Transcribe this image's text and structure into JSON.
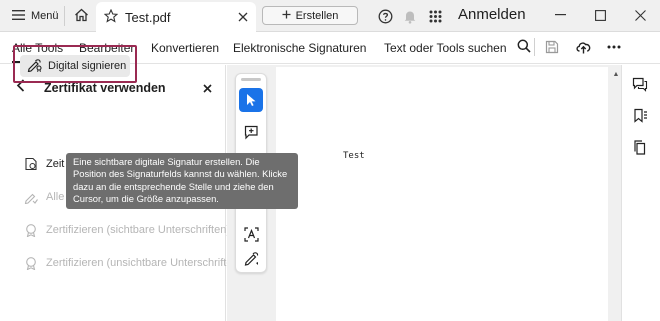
{
  "titlebar": {
    "menu_label": "Menü",
    "tab_title": "Test.pdf",
    "new_label": "Erstellen",
    "signin_label": "Anmelden",
    "icons": [
      "hamburger-menu-icon",
      "home-icon",
      "star-icon",
      "close-icon",
      "plus-icon",
      "help-icon",
      "bell-icon",
      "apps-grid-icon",
      "minimize-icon",
      "maximize-icon",
      "window-close-icon"
    ]
  },
  "toolbar": {
    "tabs": [
      {
        "label": "Alle Tools",
        "active": true
      },
      {
        "label": "Bearbeiten",
        "active": false
      },
      {
        "label": "Konvertieren",
        "active": false
      },
      {
        "label": "Elektronische Signaturen",
        "active": false
      }
    ],
    "search_label": "Text oder Tools suchen",
    "icons": [
      "search-icon",
      "save-icon",
      "upload-cloud-icon",
      "more-options-icon"
    ]
  },
  "left_panel": {
    "title": "Zertifikat verwenden",
    "primary_item": {
      "label": "Digital signieren",
      "icon": "sign-pen-icon"
    },
    "items": [
      {
        "label": "Zeit",
        "icon": "clock-icon",
        "disabled": false
      },
      {
        "label": "Alle",
        "icon": "verify-pen-icon",
        "disabled": true
      },
      {
        "label": "Zertifizieren (sichtbare Unterschriften)",
        "icon": "certificate-icon",
        "disabled": true
      },
      {
        "label": "Zertifizieren (unsichtbare Unterschriften)",
        "icon": "certificate-icon",
        "disabled": true
      }
    ],
    "highlight_color": "#9a2a52"
  },
  "tooltip": {
    "text": "Eine sichtbare digitale Signatur erstellen. Die Position des Signaturfelds kannst du wählen. Klicke dazu an die entsprechende Stelle und ziehe den Cursor, um die Größe anzupassen."
  },
  "vertical_toolbar": {
    "tools": [
      "select-cursor-icon",
      "add-comment-icon",
      "text-select-icon",
      "pen-draw-icon"
    ],
    "selected_color": "#1a73e8"
  },
  "document": {
    "text": "Test"
  },
  "right_rail": {
    "icons": [
      "comments-icon",
      "bookmark-icon",
      "pages-icon"
    ]
  }
}
